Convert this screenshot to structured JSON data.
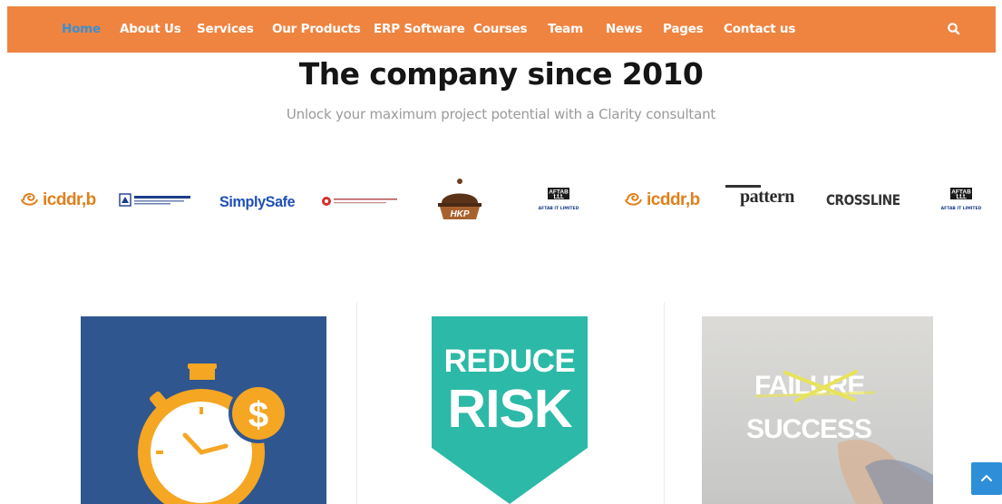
{
  "nav": {
    "items": [
      {
        "label": "Home",
        "active": true
      },
      {
        "label": "About Us"
      },
      {
        "label": "Services"
      },
      {
        "label": "Our Products"
      },
      {
        "label": "ERP Software"
      },
      {
        "label": "Courses"
      },
      {
        "label": "Team"
      },
      {
        "label": "News"
      },
      {
        "label": "Pages"
      },
      {
        "label": "Contact us"
      }
    ],
    "search_icon": "search-icon",
    "bg_color": "#ef8441",
    "active_color": "#3b8fd0"
  },
  "hero": {
    "title": "The company since 2010",
    "subtitle": "Unlock your maximum project potential with a Clarity consultant"
  },
  "clients": {
    "logos": [
      {
        "name": "icddr-b",
        "text": "icddr,b"
      },
      {
        "name": "bangla-org",
        "text": "বাংলাদেশ স্মৃতি শিল্প সমিতি"
      },
      {
        "name": "simplysafe",
        "text": "SimplySafe"
      },
      {
        "name": "red-logo-org",
        "text": "DHAKA BIO GAS SUPPLY"
      },
      {
        "name": "hkp",
        "text": "HKP"
      },
      {
        "name": "aftab",
        "text": "AFTAB",
        "sub": "AFTAB IT LIMITED"
      },
      {
        "name": "icddr-b-2",
        "text": "icddr,b"
      },
      {
        "name": "pattern",
        "text": "pattern"
      },
      {
        "name": "crossline",
        "text": "CROSSLINE"
      },
      {
        "name": "aftab-2",
        "text": "AFTAB",
        "sub": "AFTAB IT LIMITED"
      }
    ]
  },
  "features": {
    "card1": {
      "icon": "stopwatch-dollar-icon",
      "symbol": "$"
    },
    "card2": {
      "line1": "REDUCE",
      "line2": "RISK"
    },
    "card3": {
      "crossed": "FAILURE",
      "word": "SUCCESS"
    }
  },
  "back_to_top": {
    "icon": "chevron-up-icon"
  }
}
